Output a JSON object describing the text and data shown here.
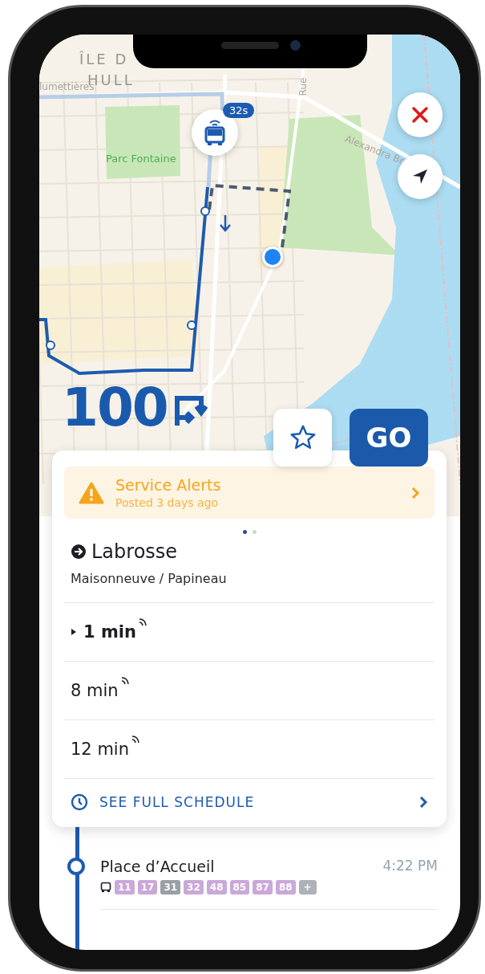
{
  "map": {
    "labels": [
      {
        "kind": "district",
        "text": "ÎLE D"
      },
      {
        "kind": "district",
        "text": "HULL"
      },
      {
        "kind": "street",
        "text": "lumettières"
      },
      {
        "kind": "park",
        "text": "Parc Fontaine"
      },
      {
        "kind": "street-vertical",
        "text": "Rue"
      },
      {
        "kind": "street-angled",
        "text": "Alexandra Br"
      }
    ],
    "vehicle_badge": "32s",
    "route_number": "100"
  },
  "actions": {
    "go": "GO",
    "favorite": false
  },
  "alert": {
    "title": "Service Alerts",
    "subtitle": "Posted 3 days ago"
  },
  "pager": [
    {
      "selected": true
    },
    {
      "selected": false
    }
  ],
  "direction": {
    "destination": "Labrosse",
    "via": "Maisonneuve / Papineau"
  },
  "departures": [
    {
      "time": "1 min",
      "selected": true,
      "realtime": true
    },
    {
      "time": "8 min",
      "selected": false,
      "realtime": true
    },
    {
      "time": "12 min",
      "selected": false,
      "realtime": true
    }
  ],
  "schedule_link": "SEE FULL SCHEDULE",
  "stops": [
    {
      "name": "Place d’Accueil",
      "time": "4:22 PM",
      "routes": [
        {
          "label": "11",
          "color": "#caa8d9"
        },
        {
          "label": "17",
          "color": "#caa8d9"
        },
        {
          "label": "31",
          "color": "#9b9fa6"
        },
        {
          "label": "32",
          "color": "#caa8d9"
        },
        {
          "label": "48",
          "color": "#caa8d9"
        },
        {
          "label": "85",
          "color": "#caa8d9"
        },
        {
          "label": "87",
          "color": "#caa8d9"
        },
        {
          "label": "88",
          "color": "#caa8d9"
        },
        {
          "label": "+",
          "color": "#aeb2b8"
        }
      ]
    }
  ]
}
